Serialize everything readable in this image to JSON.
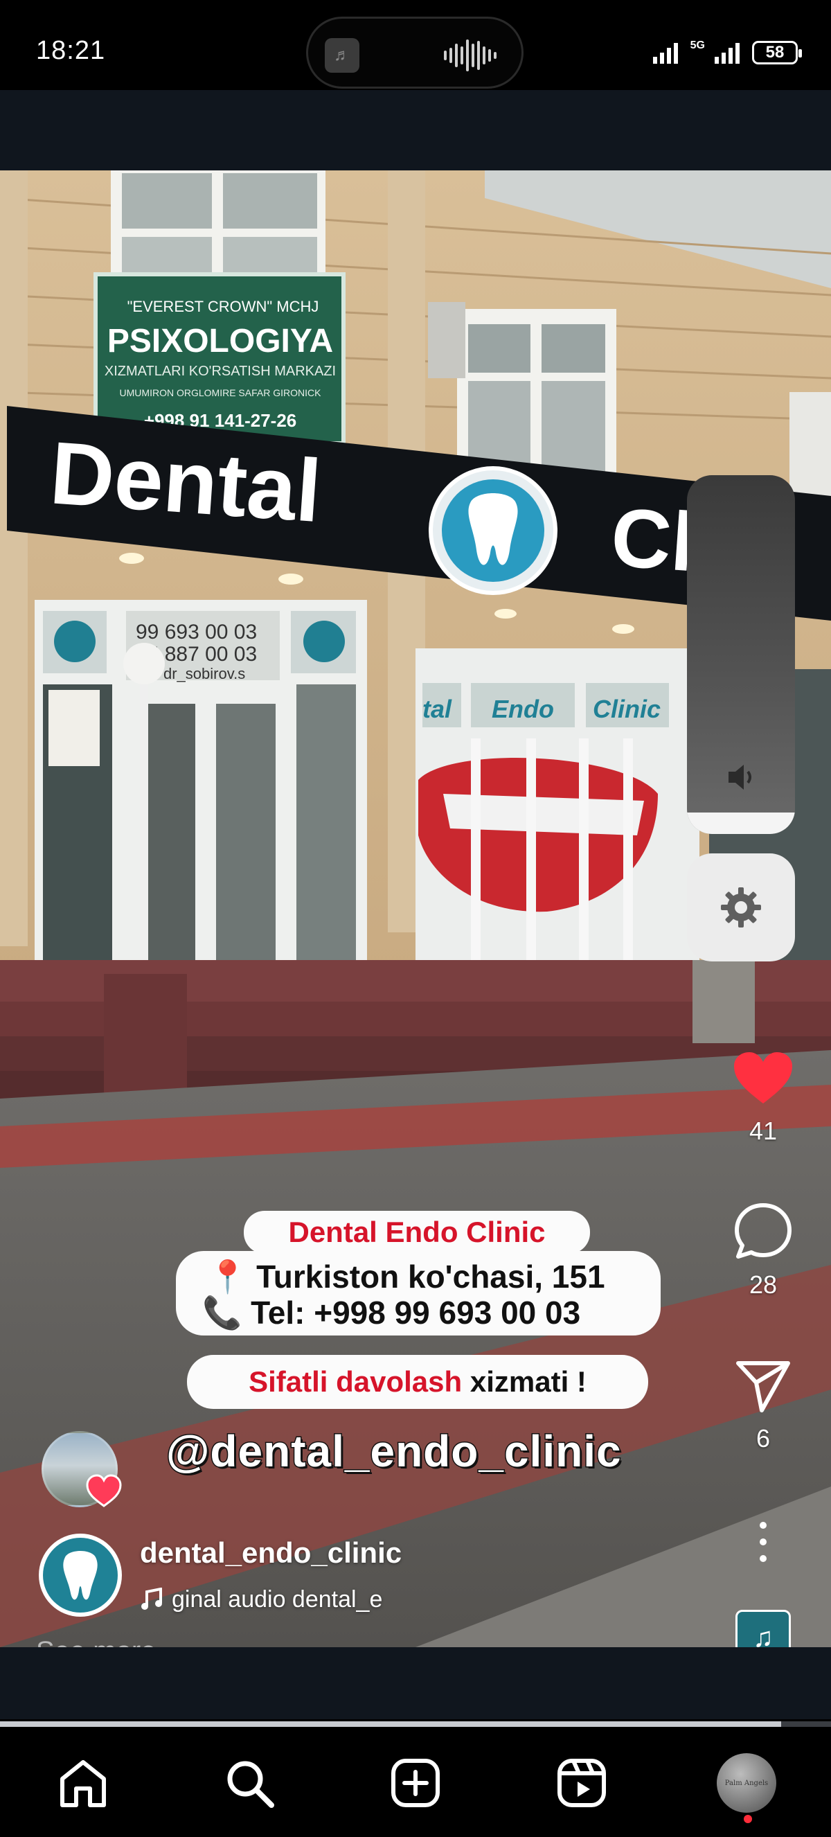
{
  "status_bar": {
    "time": "18:21",
    "network": "5G",
    "battery": "58"
  },
  "video": {
    "signs": {
      "big_sign_left": "Dental",
      "big_sign_right": "Cli",
      "green_sign_header": "\"EVEREST CROWN\" MCHJ",
      "green_sign_title": "PSIXOLOGIYA",
      "green_sign_sub": "XIZMATLARI KO'RSATISH MARKAZI",
      "green_sign_sub2": "UMUMIRON ORGLOMIRE SAFAR GIRONICK",
      "green_sign_phone": "+998 91 141-27-26",
      "door_phone_1": "99 693 00 03",
      "door_phone_2": "95 887 00 03",
      "door_handle_text": "dr_sobirov.s",
      "window_words": [
        "tal",
        "Endo",
        "Clinic"
      ]
    },
    "overlay_card": {
      "clinic_name": "Dental Endo Clinic",
      "address_icon": "pin-icon",
      "address": "Turkiston ko'chasi, 151",
      "phone_icon": "phone-icon",
      "phone": "Tel: +998 99 693 00 03"
    },
    "slogan": {
      "highlight": "Sifatli davolash",
      "rest": "xizmati !"
    },
    "handle_text": "@dental_endo_clinic"
  },
  "controls": {
    "volume_level": 0.06,
    "volume_icon": "speaker-icon",
    "settings_icon": "gear-icon"
  },
  "actions": {
    "likes": "41",
    "comments": "28",
    "shares": "6",
    "liked_color": "#ff3040"
  },
  "post": {
    "username": "dental_endo_clinic",
    "audio_text": "ginal audio    dental_e",
    "see_more": "See more"
  },
  "progress": 0.94,
  "nav": {
    "items": [
      "home-icon",
      "search-icon",
      "create-icon",
      "reels-icon",
      "profile-avatar"
    ],
    "avatar_text": "Palm Angels"
  }
}
